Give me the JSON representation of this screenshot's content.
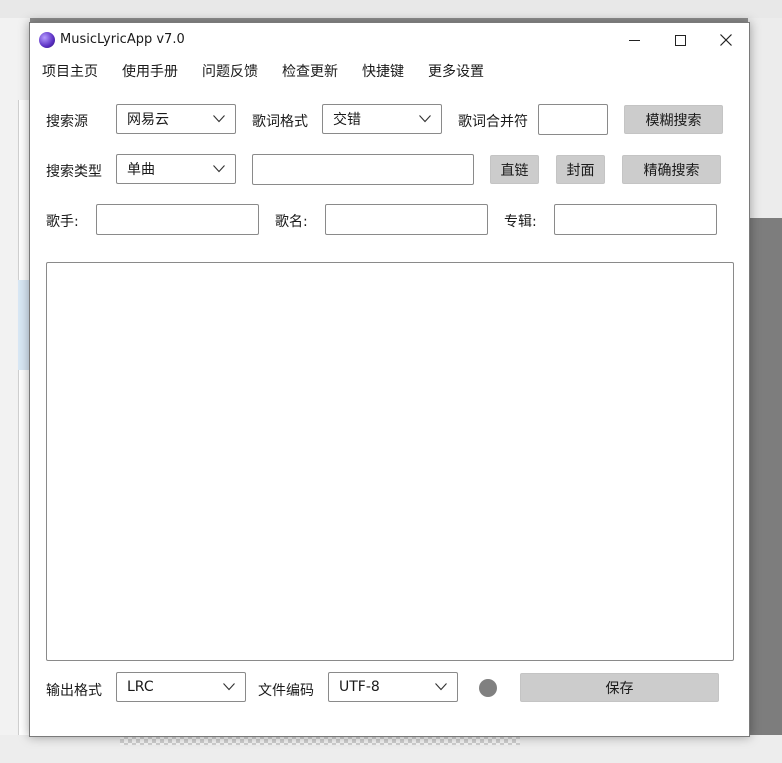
{
  "window": {
    "title": "MusicLyricApp v7.0"
  },
  "menu": [
    "项目主页",
    "使用手册",
    "问题反馈",
    "检查更新",
    "快捷键",
    "更多设置"
  ],
  "search": {
    "source_label": "搜索源",
    "source_value": "网易云",
    "lyric_format_label": "歌词格式",
    "lyric_format_value": "交错",
    "merge_char_label": "歌词合并符",
    "merge_char_value": "",
    "fuzzy_search_button": "模糊搜索",
    "search_type_label": "搜索类型",
    "search_type_value": "单曲",
    "keyword_value": "",
    "direct_link_button": "直链",
    "cover_button": "封面",
    "exact_search_button": "精确搜索"
  },
  "song_info": {
    "singer_label": "歌手:",
    "song_name_label": "歌名:",
    "album_label": "专辑:"
  },
  "lyrics": {
    "content": ""
  },
  "output": {
    "format_label": "输出格式",
    "format_value": "LRC",
    "encoding_label": "文件编码",
    "encoding_value": "UTF-8",
    "save_button": "保存",
    "status_color": "#808080"
  },
  "icons": [
    "app-logo-icon",
    "minimize-icon",
    "maximize-icon",
    "close-icon",
    "chevron-down-icon"
  ]
}
